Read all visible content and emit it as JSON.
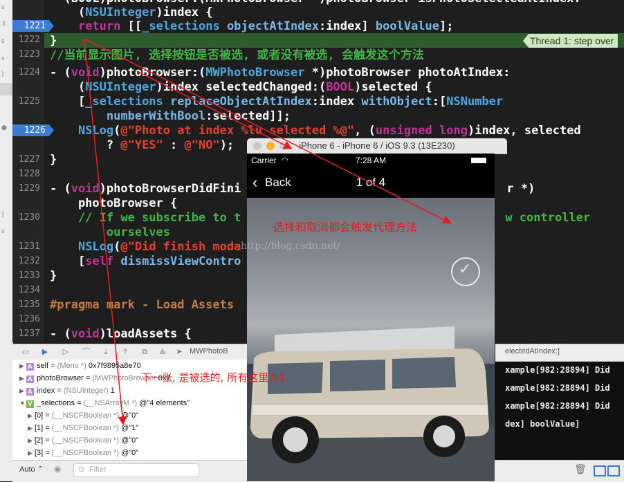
{
  "colors": {
    "keyword": "#c2349b",
    "type": "#4fa8e0",
    "string": "#e0442f",
    "comment": "#41b645",
    "thread_badge": "#cfe8c4",
    "breakpoint": "#3b7bd4",
    "annotation": "#e02020"
  },
  "editor": {
    "line_numbers": [
      "1221",
      "1222",
      "1223",
      "1224",
      "1225",
      "1226",
      "1227",
      "1228",
      "1229",
      "1230",
      "1231",
      "1232",
      "1233",
      "1234",
      "1235",
      "1236",
      "1237"
    ],
    "breakpoint_lines": [
      "1221",
      "1226"
    ],
    "code": {
      "l0": "- (BOOL)photoBrowser:(MWPhotoBrowser *)photoBrowser isPhotoSelectedAtIndex:",
      "l1a": "    (",
      "l1b": "NSUInteger",
      "l1c": ")index {",
      "l2a": "    ",
      "l2b": "return",
      "l2c": " [[",
      "l2d": "_selections",
      "l2e": " ",
      "l2f": "objectAtIndex",
      "l2g": ":index] ",
      "l2h": "boolValue",
      "l2i": "];",
      "l3": "}",
      "l4": "//当前显示图片, 选择按钮是否被选, 或者没有被选, 会触发这个方法",
      "l5a": "- (",
      "l5b": "void",
      "l5c": ")photoBrowser:(",
      "l5d": "MWPhotoBrowser",
      "l5e": " *)photoBrowser photoAtIndex:",
      "l6a": "    (",
      "l6b": "NSUInteger",
      "l6c": ")index selectedChanged:(",
      "l6d": "BOOL",
      "l6e": ")selected {",
      "l7a": "    [",
      "l7b": "_selections",
      "l7c": " ",
      "l7d": "replaceObjectAtIndex",
      "l7e": ":index ",
      "l7f": "withObject",
      "l7g": ":[",
      "l7h": "NSNumber",
      "l8a": "        ",
      "l8b": "numberWithBool",
      "l8c": ":selected]];",
      "l9a": "    ",
      "l9b": "NSLog",
      "l9c": "(",
      "l9d": "@\"Photo at index %lu selected %@\"",
      "l9e": ", (",
      "l9f": "unsigned",
      "l9g": " ",
      "l9h": "long",
      "l9i": ")index, selected",
      "l10a": "        ? ",
      "l10b": "@\"YES\"",
      "l10c": " : ",
      "l10d": "@\"NO\"",
      "l10e": ");",
      "l11": "}",
      "l12a": "- (",
      "l12b": "void",
      "l12c": ")photoBrowserDidFini",
      "l12d": "r *)",
      "l13": "    photoBrowser {",
      "l14a": "    // If we subscribe to t",
      "l14b": "w controller",
      "l15": "        ourselves",
      "l16a": "    ",
      "l16b": "NSLog",
      "l16c": "(",
      "l16d": "@\"Did finish moda",
      "l17a": "    [",
      "l17b": "self",
      "l17c": " ",
      "l17d": "dismissViewContro",
      "l18": "}",
      "l19": "#pragma mark - Load Assets",
      "l20a": "- (",
      "l20b": "void",
      "l20c": ")loadAssets {"
    },
    "thread_badge": "Thread 1: step over"
  },
  "debug_bar": {
    "crumb": "MWPhotoB",
    "right_crumb": "electedAtIndex:]"
  },
  "variables": [
    {
      "name": "self",
      "type": "(Menu *)",
      "value": "0x7f9895a8e70",
      "badge": "A",
      "expanded": false
    },
    {
      "name": "photoBrowser",
      "type": "(MWPhotoBrowser",
      "value": "0x7",
      "badge": "A",
      "expanded": false
    },
    {
      "name": "index",
      "type": "(NSUInteger)",
      "value": "1",
      "badge": "A",
      "expanded": false
    },
    {
      "name": "_selections",
      "type": "(__NSArrayM *)",
      "value": "@\"4 elements\"",
      "badge": "V",
      "expanded": true
    },
    {
      "name": "[0]",
      "type": "(__NSCFBoolean *)",
      "value": "@\"0\""
    },
    {
      "name": "[1]",
      "type": "(__NSCFBoolean *)",
      "value": "@\"1\""
    },
    {
      "name": "[2]",
      "type": "(__NSCFBoolean *)",
      "value": "@\"0\""
    },
    {
      "name": "[3]",
      "type": "(__NSCFBoolean *)",
      "value": "@\"0\""
    }
  ],
  "console": {
    "lines": [
      "xample[982:28894] Did",
      "xample[982:28894] Did",
      "xample[982:28894] Did",
      "dex] boolValue]"
    ]
  },
  "bottom_bar": {
    "auto_label": "Auto",
    "filter_placeholder": "Filter"
  },
  "simulator": {
    "title": "iPhone 6 - iPhone 6 / iOS 9.3 (13E230)",
    "carrier": "Carrier",
    "time": "7:28 AM",
    "back_label": "Back",
    "page_counter": "1 of 4",
    "selected": true
  },
  "annotations": {
    "select_note": "选择和取消都会触发代理方法",
    "next_note": "下一张, 是被选的, 所有这里为1."
  },
  "watermark": "http://blog.csdn.net/"
}
